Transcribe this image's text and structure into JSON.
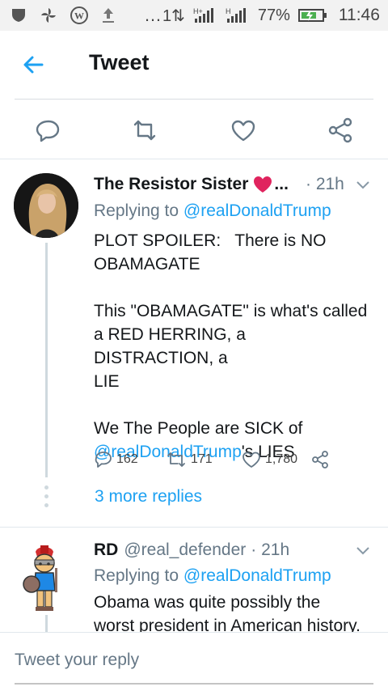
{
  "status_bar": {
    "left_icons": [
      "shield-icon",
      "pinwheel-icon",
      "wordpress-icon",
      "upload-icon"
    ],
    "more": "…",
    "data_indicator": "1⇅",
    "net1": "H+",
    "net2": "H",
    "battery": "77%",
    "time": "11:46"
  },
  "header": {
    "title": "Tweet"
  },
  "main_actions": [
    "reply-icon",
    "retweet-icon",
    "like-icon",
    "share-icon"
  ],
  "replies": [
    {
      "name": "The Resistor Sister",
      "emoji": "❤️",
      "ellipsis": "...",
      "time": "· 21h",
      "replying_prefix": "Replying to",
      "replying_to": "@realDonaldTrump",
      "body_l1": "PLOT SPOILER:   There is NO",
      "body_l2": "OBAMAGATE",
      "body_l3": "This \"OBAMAGATE\" is what's called",
      "body_l4": "a RED HERRING, a DISTRACTION, a",
      "body_l5": "LIE",
      "body_l6": "We The People are SICK of",
      "body_mention": "@realDonaldTrump",
      "body_l7_suffix": "'s LIES",
      "reply_count": "162",
      "retweet_count": "171",
      "like_count": "1,780",
      "more_replies": "3 more replies"
    },
    {
      "name": "RD",
      "handle": "@real_defender",
      "time": "· 21h",
      "replying_prefix": "Replying to",
      "replying_to": "@realDonaldTrump",
      "body_l1": "Obama was quite possibly the",
      "body_l2": "worst president in American history."
    }
  ],
  "composer": {
    "placeholder": "Tweet your reply"
  },
  "colors": {
    "link": "#1da1f2",
    "secondary": "#657786",
    "icon": "#657786"
  }
}
